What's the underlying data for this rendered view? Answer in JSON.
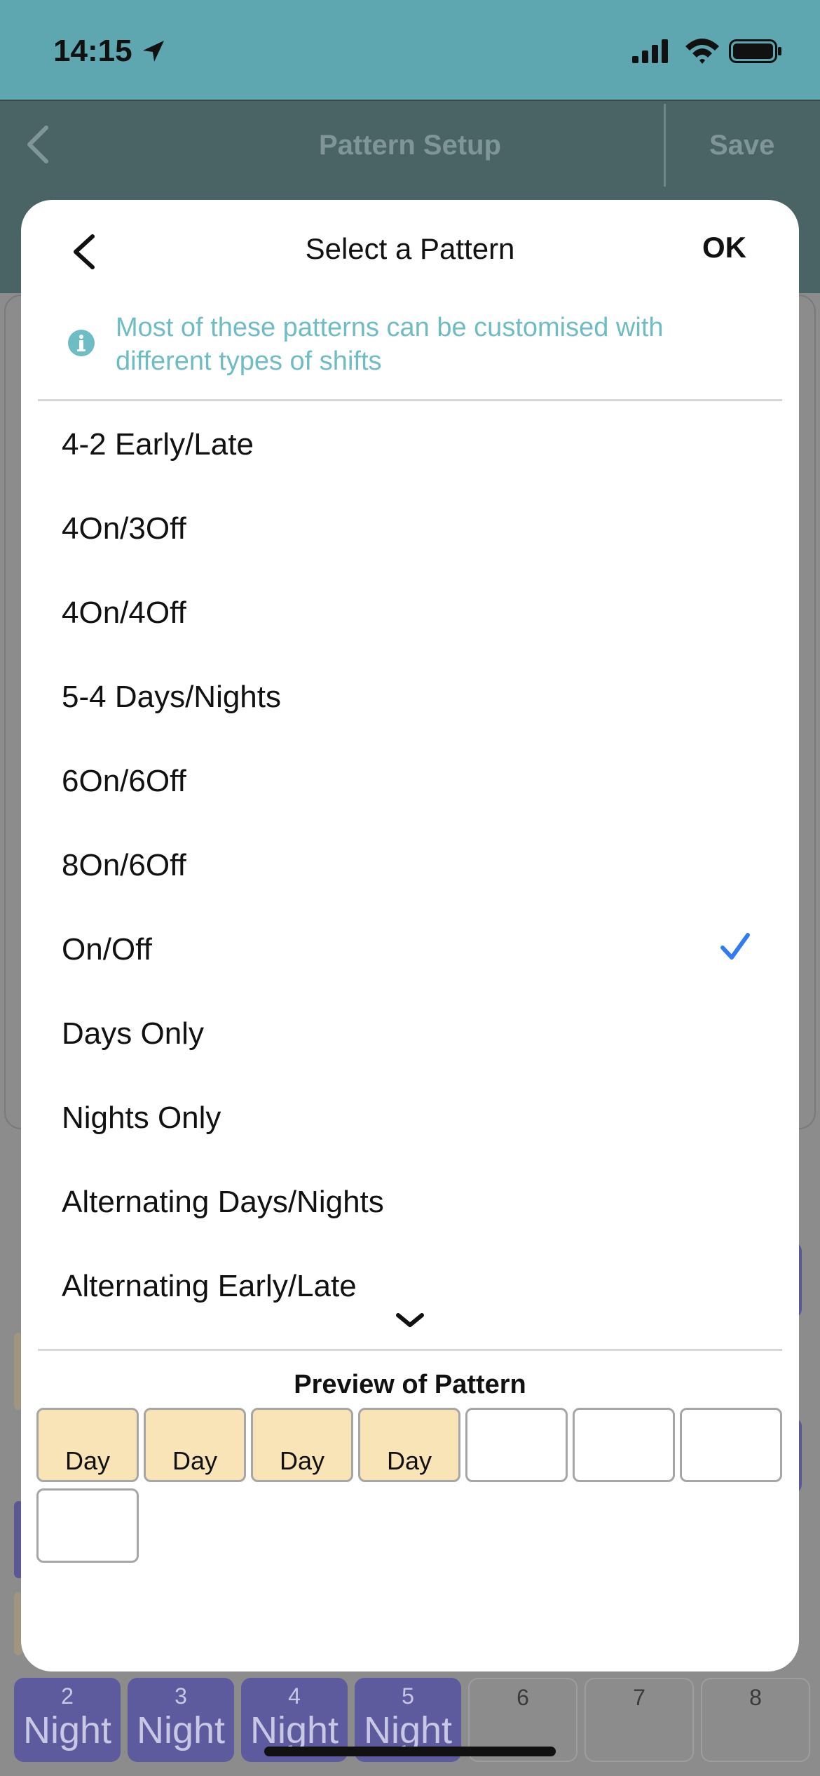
{
  "status_bar": {
    "time": "14:15",
    "icons": [
      "location-arrow-icon",
      "cellular-signal-icon",
      "wifi-icon",
      "battery-icon"
    ]
  },
  "background": {
    "nav": {
      "title": "Pattern Setup",
      "save_label": "Save",
      "back_icon": "chevron-left-icon"
    },
    "bottom_row": [
      {
        "num": "2",
        "label": "Night"
      },
      {
        "num": "3",
        "label": "Night"
      },
      {
        "num": "4",
        "label": "Night"
      },
      {
        "num": "5",
        "label": "Night"
      },
      {
        "num": "6",
        "label": ""
      },
      {
        "num": "7",
        "label": ""
      },
      {
        "num": "8",
        "label": ""
      }
    ]
  },
  "modal": {
    "title": "Select a Pattern",
    "ok_label": "OK",
    "back_icon": "chevron-left-icon",
    "info": {
      "icon": "info-icon",
      "text": "Most of these patterns can be customised with different types of shifts"
    },
    "patterns": [
      {
        "label": "4-2 Early/Late",
        "selected": false
      },
      {
        "label": "4On/3Off",
        "selected": false
      },
      {
        "label": "4On/4Off",
        "selected": false
      },
      {
        "label": "5-4 Days/Nights",
        "selected": false
      },
      {
        "label": "6On/6Off",
        "selected": false
      },
      {
        "label": "8On/6Off",
        "selected": false
      },
      {
        "label": "On/Off",
        "selected": true
      },
      {
        "label": "Days Only",
        "selected": false
      },
      {
        "label": "Nights Only",
        "selected": false
      },
      {
        "label": "Alternating Days/Nights",
        "selected": false
      },
      {
        "label": "Alternating Early/Late",
        "selected": false
      }
    ],
    "scroll_indicator_icon": "chevron-down-icon",
    "preview": {
      "title": "Preview of Pattern",
      "cells": [
        {
          "label": "Day"
        },
        {
          "label": "Day"
        },
        {
          "label": "Day"
        },
        {
          "label": "Day"
        },
        {
          "label": ""
        },
        {
          "label": ""
        },
        {
          "label": ""
        },
        {
          "label": ""
        }
      ]
    }
  },
  "colors": {
    "accent_teal": "#5ea7b0",
    "info_text": "#6ebcc4",
    "check_blue": "#2f7cf6",
    "day_fill": "#f9e4b8",
    "night_fill": "#5d5b9d"
  }
}
